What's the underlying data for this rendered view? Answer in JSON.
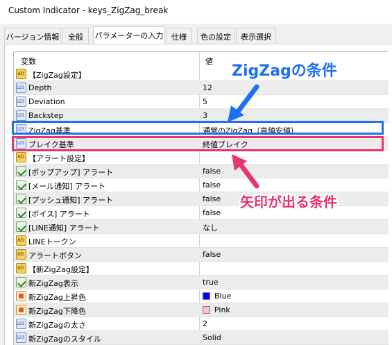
{
  "window": {
    "title": "Custom Indicator - keys_ZigZag_break"
  },
  "tabs": [
    {
      "label": "バージョン情報",
      "active": false
    },
    {
      "label": "全般",
      "active": false
    },
    {
      "label": "パラメーターの入力",
      "active": true
    },
    {
      "label": "仕様",
      "active": false
    },
    {
      "label": "色の設定",
      "active": false
    },
    {
      "label": "表示選択",
      "active": false
    }
  ],
  "grid": {
    "header": {
      "name": "変数",
      "value": "値"
    },
    "rows": [
      {
        "icon": "ab",
        "name": "【ZigZag設定】",
        "value": ""
      },
      {
        "icon": "num",
        "name": "Depth",
        "value": "12"
      },
      {
        "icon": "num",
        "name": "Deviation",
        "value": "5"
      },
      {
        "icon": "num",
        "name": "Backstep",
        "value": "3"
      },
      {
        "icon": "num",
        "name": "ZigZag基準",
        "value": "通常のZigZag（高値安値）"
      },
      {
        "icon": "num",
        "name": "ブレイク基準",
        "value": "終値ブレイク"
      },
      {
        "icon": "ab",
        "name": "【アラート設定】",
        "value": ""
      },
      {
        "icon": "bool",
        "name": "[ポップアップ] アラート",
        "value": "false"
      },
      {
        "icon": "bool",
        "name": "[メール通知] アラート",
        "value": "false"
      },
      {
        "icon": "bool",
        "name": "[プッシュ通知] アラート",
        "value": "false"
      },
      {
        "icon": "bool",
        "name": "[ボイス] アラート",
        "value": "false"
      },
      {
        "icon": "bool",
        "name": "[LINE通知] アラート",
        "value": "なし"
      },
      {
        "icon": "ab",
        "name": "LINEトークン",
        "value": ""
      },
      {
        "icon": "ab",
        "name": "アラートボタン",
        "value": "false"
      },
      {
        "icon": "ab",
        "name": "【新ZigZag設定】",
        "value": ""
      },
      {
        "icon": "bool",
        "name": "新ZigZag表示",
        "value": "true"
      },
      {
        "icon": "color",
        "name": "新ZigZag上昇色",
        "value": "Blue",
        "swatch": "#0000ff"
      },
      {
        "icon": "color",
        "name": "新ZigZag下降色",
        "value": "Pink",
        "swatch": "#ffc0cb"
      },
      {
        "icon": "num",
        "name": "新ZigZagの太さ",
        "value": "2"
      },
      {
        "icon": "num",
        "name": "新ZigZagのスタイル",
        "value": "Solid"
      }
    ]
  },
  "annotations": {
    "zigzag_condition": "ZigZagの条件",
    "arrow_condition": "矢印が出る条件"
  },
  "colors": {
    "highlight_blue": "#1e6ff2",
    "highlight_red": "#e8336d"
  }
}
